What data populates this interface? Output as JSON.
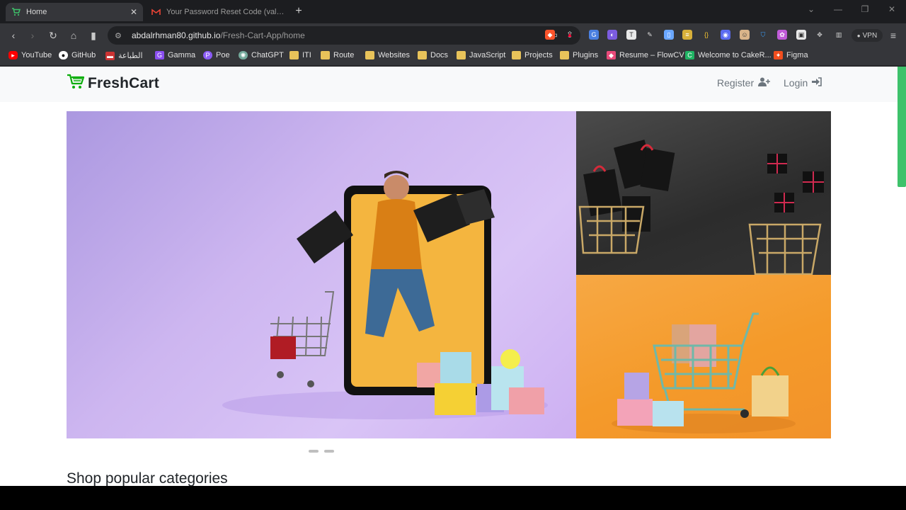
{
  "browser": {
    "tabs": [
      {
        "title": "Home",
        "icon": "freshcart-cart-icon",
        "active": true
      },
      {
        "title": "Your Password Reset Code (valid for",
        "icon": "gmail-icon",
        "active": false
      }
    ],
    "address": {
      "host": "abdalrhman80.github.io",
      "path": "/Fresh-Cart-App/home"
    },
    "vpn_label": "VPN",
    "bookmarks": [
      {
        "label": "YouTube",
        "icon": "youtube-icon"
      },
      {
        "label": "GitHub",
        "icon": "github-icon"
      },
      {
        "label": "الطباعة",
        "icon": "print-site-icon"
      },
      {
        "label": "Gamma",
        "icon": "gamma-icon"
      },
      {
        "label": "Poe",
        "icon": "poe-icon"
      },
      {
        "label": "ChatGPT",
        "icon": "chatgpt-icon"
      },
      {
        "label": "ITI",
        "icon": "folder-icon"
      },
      {
        "label": "Route",
        "icon": "folder-icon"
      },
      {
        "label": "Websites",
        "icon": "folder-icon"
      },
      {
        "label": "Docs",
        "icon": "folder-icon"
      },
      {
        "label": "JavaScript",
        "icon": "folder-icon"
      },
      {
        "label": "Projects",
        "icon": "folder-icon"
      },
      {
        "label": "Plugins",
        "icon": "folder-icon"
      },
      {
        "label": "Resume – FlowCV",
        "icon": "flowcv-icon"
      },
      {
        "label": "Welcome to CakeR...",
        "icon": "cakeresume-icon"
      },
      {
        "label": "Figma",
        "icon": "figma-icon"
      }
    ]
  },
  "page": {
    "brand": "FreshCart",
    "nav": {
      "register": "Register",
      "login": "Login"
    },
    "section_title": "Shop popular categories",
    "accent": "#0aad0a"
  }
}
